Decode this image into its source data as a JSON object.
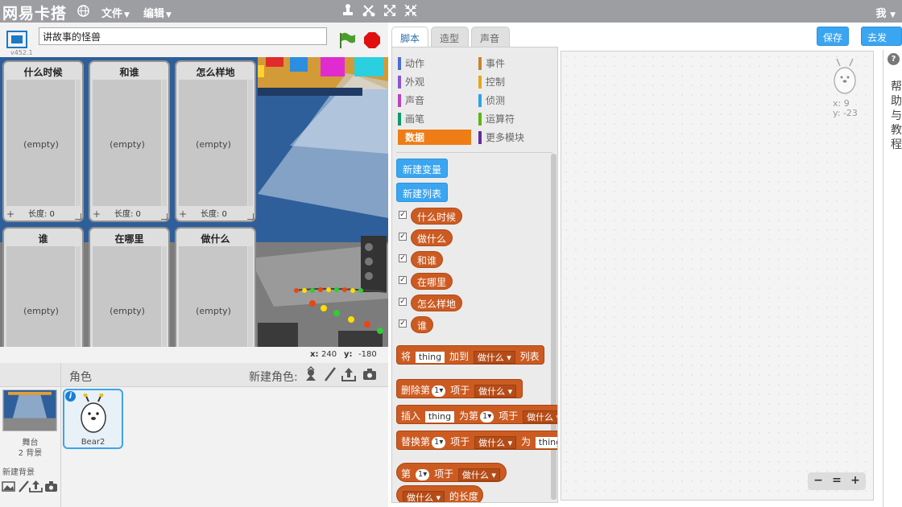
{
  "app": {
    "logo": "网易卡搭",
    "menu_file": "文件",
    "menu_edit": "编辑",
    "user": "我",
    "version": "v452.1"
  },
  "project": {
    "title": "讲故事的怪兽"
  },
  "stage": {
    "lists": [
      {
        "title": "什么时候",
        "empty": "(empty)",
        "plus": "+",
        "length_label": "长度: 0"
      },
      {
        "title": "和谁",
        "empty": "(empty)",
        "plus": "+",
        "length_label": "长度: 0"
      },
      {
        "title": "怎么样地",
        "empty": "(empty)",
        "plus": "+",
        "length_label": "长度: 0"
      },
      {
        "title": "谁",
        "empty": "(empty)"
      },
      {
        "title": "在哪里",
        "empty": "(empty)"
      },
      {
        "title": "做什么",
        "empty": "(empty)"
      }
    ],
    "coords": {
      "x_label": "x:",
      "x": "240",
      "y_label": "y:",
      "y": "-180"
    }
  },
  "sprites": {
    "header": "角色",
    "new_sprite": "新建角色:",
    "stage_name": "舞台",
    "stage_backdrops": "2 背景",
    "new_backdrop": "新建背景",
    "selected": {
      "name": "Bear2",
      "info": "i"
    }
  },
  "tabs": [
    "脚本",
    "造型",
    "声音"
  ],
  "categories": {
    "left": [
      {
        "label": "动作",
        "color": "#4a6cd4"
      },
      {
        "label": "外观",
        "color": "#8a55d7"
      },
      {
        "label": "声音",
        "color": "#bb42c3"
      },
      {
        "label": "画笔",
        "color": "#0e9a6c"
      },
      {
        "label": "数据",
        "color": "#ee7d16"
      }
    ],
    "right": [
      {
        "label": "事件",
        "color": "#c88330"
      },
      {
        "label": "控制",
        "color": "#e1a91a"
      },
      {
        "label": "侦测",
        "color": "#2ca5e2"
      },
      {
        "label": "运算符",
        "color": "#5cb712"
      },
      {
        "label": "更多模块",
        "color": "#632d99"
      }
    ],
    "selected": "数据"
  },
  "palette": {
    "new_variable": "新建变量",
    "new_list": "新建列表",
    "checkbox_mark": "✓",
    "list_reporters": [
      "什么时候",
      "做什么",
      "和谁",
      "在哪里",
      "怎么样地",
      "谁"
    ],
    "blocks": {
      "add": {
        "p1": "将",
        "thing": "thing",
        "p2": "加到",
        "list": "做什么",
        "p3": "列表"
      },
      "delete": {
        "p1": "删除第",
        "num": "1",
        "p2": "项于",
        "list": "做什么"
      },
      "insert": {
        "p1": "插入",
        "thing": "thing",
        "p2": "为第",
        "num": "1",
        "p3": "项于",
        "list": "做什么"
      },
      "replace": {
        "p1": "替换第",
        "num": "1",
        "p2": "项于",
        "list": "做什么",
        "p3": "为",
        "thing": "thing"
      },
      "item": {
        "p1": "第",
        "num": "1",
        "p2": "项于",
        "list": "做什么"
      },
      "length": {
        "list": "做什么",
        "p1": "的长度"
      }
    }
  },
  "actions": {
    "save": "保存",
    "publish": "去发布"
  },
  "scripts_area": {
    "x_label": "x: 9",
    "y_label": "y: -23"
  },
  "zoom": {
    "out": "−",
    "reset": "=",
    "in": "+"
  },
  "help": {
    "icon": "?",
    "text": "帮助与教程"
  },
  "colors": {
    "accent": "#3aa5f0",
    "data": "#ee7d16",
    "list_block": "#cc5b22"
  }
}
